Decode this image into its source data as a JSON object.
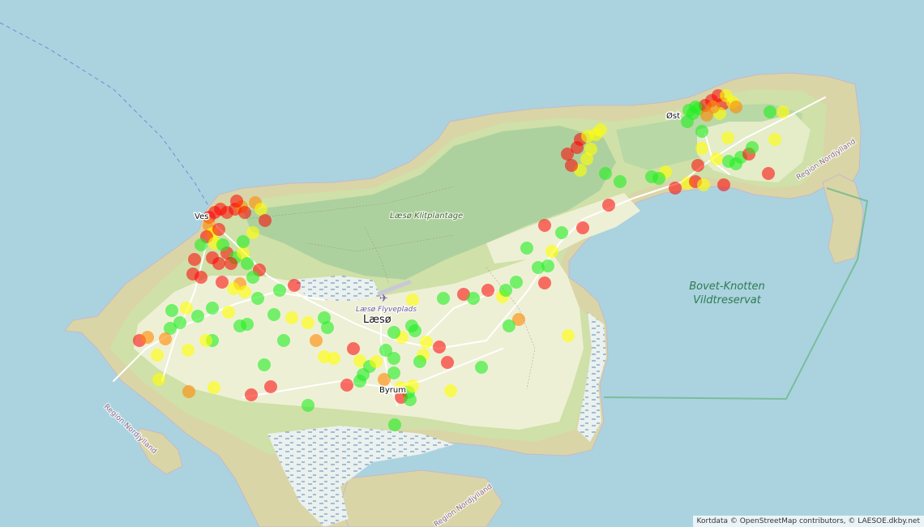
{
  "labels": {
    "vesteroe": "Ves",
    "oesteroe": "Øst",
    "island": "Læsø",
    "plantage": "Læsø Klitplantage",
    "airport": "Læsø Flyveplads",
    "byrum": "Byrum",
    "reserve_line1": "Bovet-Knotten",
    "reserve_line2": "Vildtreservat",
    "region_ne": "Region Nordjylland",
    "region_sw": "Region Nordjylland",
    "region_s": "Region Nordjylland"
  },
  "attribution": "Kortdata © OpenStreetMap contributors, © LAESOE.dkby.net",
  "icons": {
    "airport": "airplane-icon"
  },
  "colors": {
    "sea": "#aad3df",
    "beach": "#d6d1a2",
    "heath": "#cfe0a8",
    "forest": "#add19e",
    "farmland": "#eef0d5",
    "reserve_border": "#6fb88a",
    "red": "#ff0000",
    "orange": "#ff8800",
    "yellow": "#ffff00",
    "green": "#22ee22"
  },
  "marker_levels": [
    {
      "name": "red",
      "color": "#ff0000"
    },
    {
      "name": "orange",
      "color": "#ff8800"
    },
    {
      "name": "yellow",
      "color": "#ffff00"
    },
    {
      "name": "green",
      "color": "#22ee22"
    }
  ]
}
